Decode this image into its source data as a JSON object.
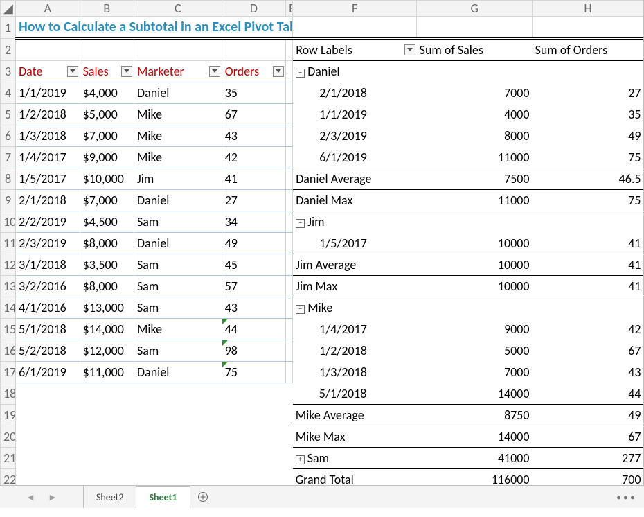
{
  "title": "How to Calculate a Subtotal in an Excel Pivot Table",
  "columns": [
    "A",
    "B",
    "C",
    "D",
    "E",
    "F",
    "G",
    "H"
  ],
  "table": {
    "headers": {
      "date": "Date",
      "sales": "Sales",
      "marketer": "Marketer",
      "orders": "Orders"
    },
    "rows": [
      {
        "date": "1/1/2019",
        "sales": "$4,000",
        "marketer": "Daniel",
        "orders": "35",
        "tri": false
      },
      {
        "date": "1/2/2018",
        "sales": "$5,000",
        "marketer": "Mike",
        "orders": "67",
        "tri": false
      },
      {
        "date": "1/3/2018",
        "sales": "$7,000",
        "marketer": "Mike",
        "orders": "43",
        "tri": false
      },
      {
        "date": "1/4/2017",
        "sales": "$9,000",
        "marketer": "Mike",
        "orders": "42",
        "tri": false
      },
      {
        "date": "1/5/2017",
        "sales": "$10,000",
        "marketer": "Jim",
        "orders": "41",
        "tri": false
      },
      {
        "date": "2/1/2018",
        "sales": "$7,000",
        "marketer": "Daniel",
        "orders": "27",
        "tri": false
      },
      {
        "date": "2/2/2019",
        "sales": "$4,500",
        "marketer": "Sam",
        "orders": "34",
        "tri": false
      },
      {
        "date": "2/3/2019",
        "sales": "$8,000",
        "marketer": "Daniel",
        "orders": "49",
        "tri": false
      },
      {
        "date": "3/1/2018",
        "sales": "$3,500",
        "marketer": "Sam",
        "orders": "45",
        "tri": false
      },
      {
        "date": "3/2/2016",
        "sales": "$8,000",
        "marketer": "Sam",
        "orders": "57",
        "tri": false
      },
      {
        "date": "4/1/2016",
        "sales": "$13,000",
        "marketer": "Sam",
        "orders": "43",
        "tri": false
      },
      {
        "date": "5/1/2018",
        "sales": "$14,000",
        "marketer": "Mike",
        "orders": "44",
        "tri": true
      },
      {
        "date": "5/2/2018",
        "sales": "$12,000",
        "marketer": "Sam",
        "orders": "98",
        "tri": true
      },
      {
        "date": "6/1/2019",
        "sales": "$11,000",
        "marketer": "Daniel",
        "orders": "75",
        "tri": true
      }
    ]
  },
  "pivot": {
    "headers": {
      "row_labels": "Row Labels",
      "sum_sales": "Sum of Sales",
      "sum_orders": "Sum of Orders"
    },
    "rows": [
      {
        "type": "group",
        "label": "Daniel",
        "sales": "",
        "orders": "",
        "toggle": "−"
      },
      {
        "type": "detail",
        "label": "2/1/2018",
        "sales": "7000",
        "orders": "27"
      },
      {
        "type": "detail",
        "label": "1/1/2019",
        "sales": "4000",
        "orders": "35"
      },
      {
        "type": "detail",
        "label": "2/3/2019",
        "sales": "8000",
        "orders": "49"
      },
      {
        "type": "detail_last",
        "label": "6/1/2019",
        "sales": "11000",
        "orders": "75"
      },
      {
        "type": "sub",
        "label": "Daniel Average",
        "sales": "7500",
        "orders": "46.5"
      },
      {
        "type": "sub",
        "label": "Daniel Max",
        "sales": "11000",
        "orders": "75"
      },
      {
        "type": "group",
        "label": "Jim",
        "sales": "",
        "orders": "",
        "toggle": "−"
      },
      {
        "type": "detail_last",
        "label": "1/5/2017",
        "sales": "10000",
        "orders": "41"
      },
      {
        "type": "sub",
        "label": "Jim Average",
        "sales": "10000",
        "orders": "41"
      },
      {
        "type": "sub",
        "label": "Jim Max",
        "sales": "10000",
        "orders": "41"
      },
      {
        "type": "group",
        "label": "Mike",
        "sales": "",
        "orders": "",
        "toggle": "−"
      },
      {
        "type": "detail",
        "label": "1/4/2017",
        "sales": "9000",
        "orders": "42"
      },
      {
        "type": "detail",
        "label": "1/2/2018",
        "sales": "5000",
        "orders": "67"
      },
      {
        "type": "detail",
        "label": "1/3/2018",
        "sales": "7000",
        "orders": "43"
      },
      {
        "type": "detail_last",
        "label": "5/1/2018",
        "sales": "14000",
        "orders": "44"
      },
      {
        "type": "sub",
        "label": "Mike Average",
        "sales": "8750",
        "orders": "49"
      },
      {
        "type": "sub",
        "label": "Mike Max",
        "sales": "14000",
        "orders": "67"
      },
      {
        "type": "group_collapsed",
        "label": "Sam",
        "sales": "41000",
        "orders": "277",
        "toggle": "+"
      },
      {
        "type": "grand",
        "label": "Grand Total",
        "sales": "116000",
        "orders": "700"
      }
    ]
  },
  "tabs": {
    "sheet2": "Sheet2",
    "sheet1": "Sheet1"
  }
}
